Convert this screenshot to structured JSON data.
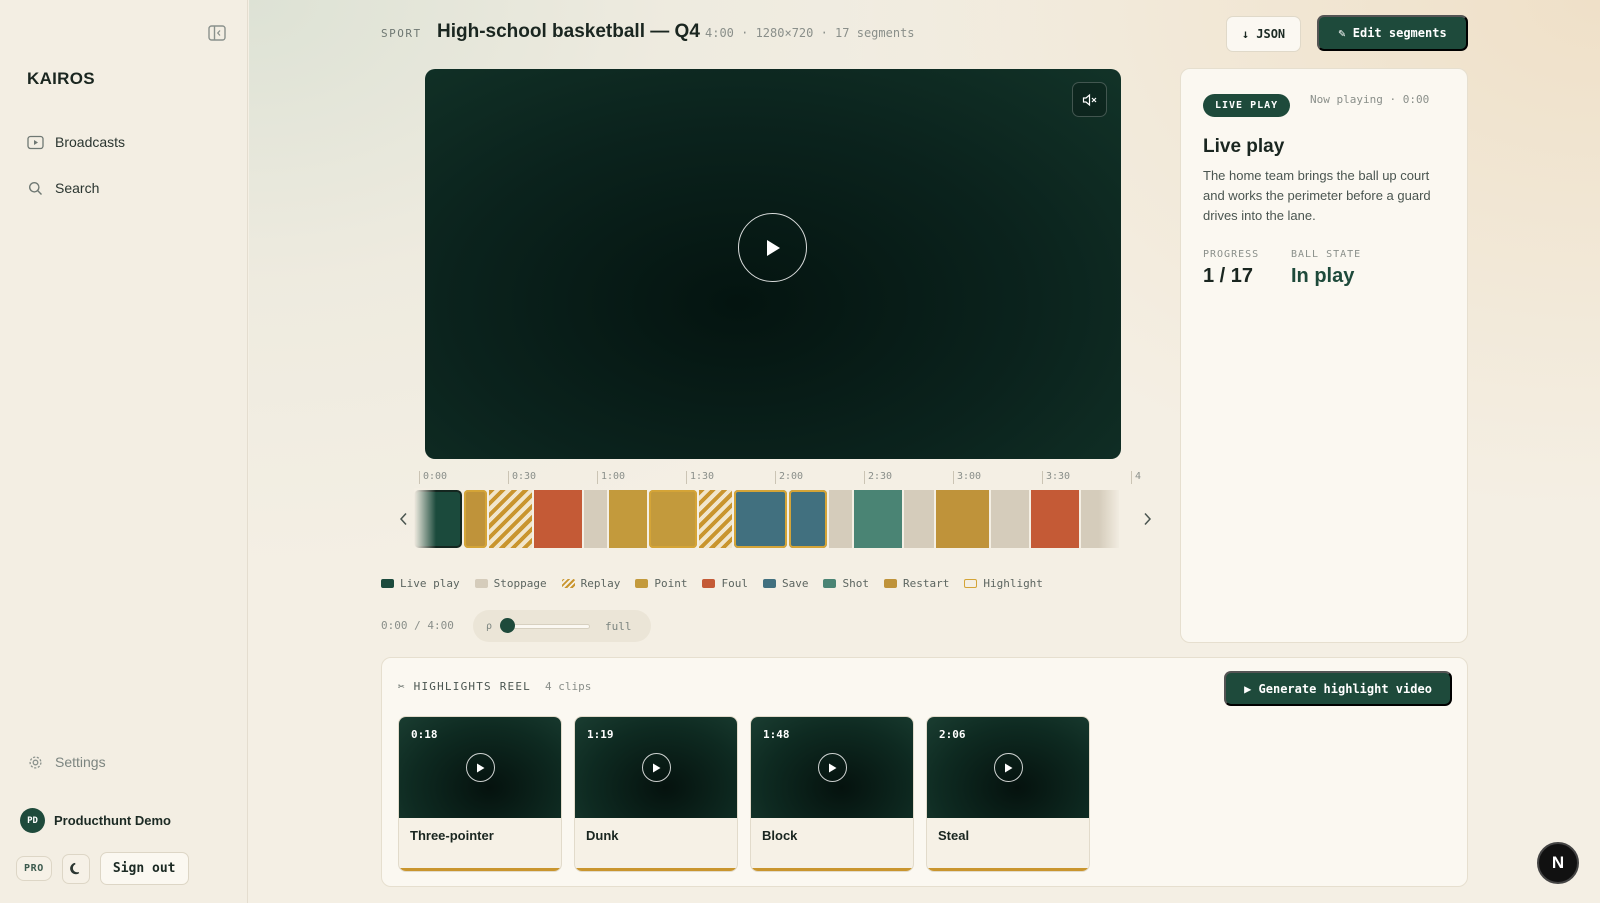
{
  "sidebar": {
    "brand": "KAIROS",
    "nav": [
      {
        "label": "Broadcasts",
        "icon": "broadcast-icon"
      },
      {
        "label": "Search",
        "icon": "search-icon"
      }
    ],
    "settings_label": "Settings",
    "user": {
      "initials": "PD",
      "name": "Producthunt Demo"
    },
    "plan_badge": "PRO",
    "signout_label": "Sign out"
  },
  "header": {
    "sport_label": "SPORT",
    "title": "High-school basketball — Q4",
    "meta": "4:00 · 1280×720 · 17 segments",
    "json_button": "↓ JSON",
    "edit_button": "✎ Edit segments"
  },
  "timeline": {
    "ticks": [
      "0:00",
      "0:30",
      "1:00",
      "1:30",
      "2:00",
      "2:30",
      "3:00",
      "3:30",
      "4"
    ],
    "segments": [
      {
        "type": "live",
        "dur": 1
      },
      {
        "type": "restart",
        "dur": 0.5,
        "highlight": true
      },
      {
        "type": "replay",
        "dur": 0.9
      },
      {
        "type": "foul",
        "dur": 1
      },
      {
        "type": "stoppage",
        "dur": 0.5
      },
      {
        "type": "point",
        "dur": 0.8
      },
      {
        "type": "point",
        "dur": 1,
        "highlight": true
      },
      {
        "type": "replay",
        "dur": 0.7
      },
      {
        "type": "save",
        "dur": 1.1,
        "highlight": true
      },
      {
        "type": "save",
        "dur": 0.8,
        "highlight": true
      },
      {
        "type": "stoppage",
        "dur": 0.5
      },
      {
        "type": "shot",
        "dur": 1
      },
      {
        "type": "stoppage",
        "dur": 0.65
      },
      {
        "type": "restart",
        "dur": 1.1
      },
      {
        "type": "stoppage",
        "dur": 0.8
      },
      {
        "type": "foul",
        "dur": 1
      },
      {
        "type": "stoppage",
        "dur": 0.8
      }
    ],
    "current_index": 0
  },
  "legend": [
    {
      "label": "Live play",
      "type": "live"
    },
    {
      "label": "Stoppage",
      "type": "stoppage"
    },
    {
      "label": "Replay",
      "type": "replay"
    },
    {
      "label": "Point",
      "type": "point"
    },
    {
      "label": "Foul",
      "type": "foul"
    },
    {
      "label": "Save",
      "type": "save"
    },
    {
      "label": "Shot",
      "type": "shot"
    },
    {
      "label": "Restart",
      "type": "restart"
    },
    {
      "label": "Highlight",
      "type": "highlight"
    }
  ],
  "colors": {
    "live": "#1b4a3c",
    "stoppage": "#d5ccbb",
    "replay": "#c9952e",
    "point": "#c39a3c",
    "foul": "#c45a36",
    "save": "#41707f",
    "shot": "#4a8474",
    "restart": "#bf933a",
    "highlight": "#d4a437",
    "accent": "#1e4a3b"
  },
  "player": {
    "time_readout": "0:00 / 4:00",
    "zoom_icon": "ρ",
    "zoom_label": "full",
    "zoom_level": 0
  },
  "info": {
    "badge": "LIVE PLAY",
    "now_playing": "Now playing · 0:00",
    "title": "Live play",
    "description": "The home team brings the ball up court and works the perimeter before a guard drives into the lane.",
    "progress_label": "PROGRESS",
    "progress_value": "1 / 17",
    "ball_label": "BALL STATE",
    "ball_value": "In play"
  },
  "reel": {
    "heading": "✂ HIGHLIGHTS REEL",
    "count": "4 clips",
    "generate_button": "▶ Generate highlight video",
    "clips": [
      {
        "time": "0:18",
        "title": "Three-pointer"
      },
      {
        "time": "1:19",
        "title": "Dunk"
      },
      {
        "time": "1:48",
        "title": "Block"
      },
      {
        "time": "2:06",
        "title": "Steal"
      }
    ]
  },
  "corner_badge": "N"
}
